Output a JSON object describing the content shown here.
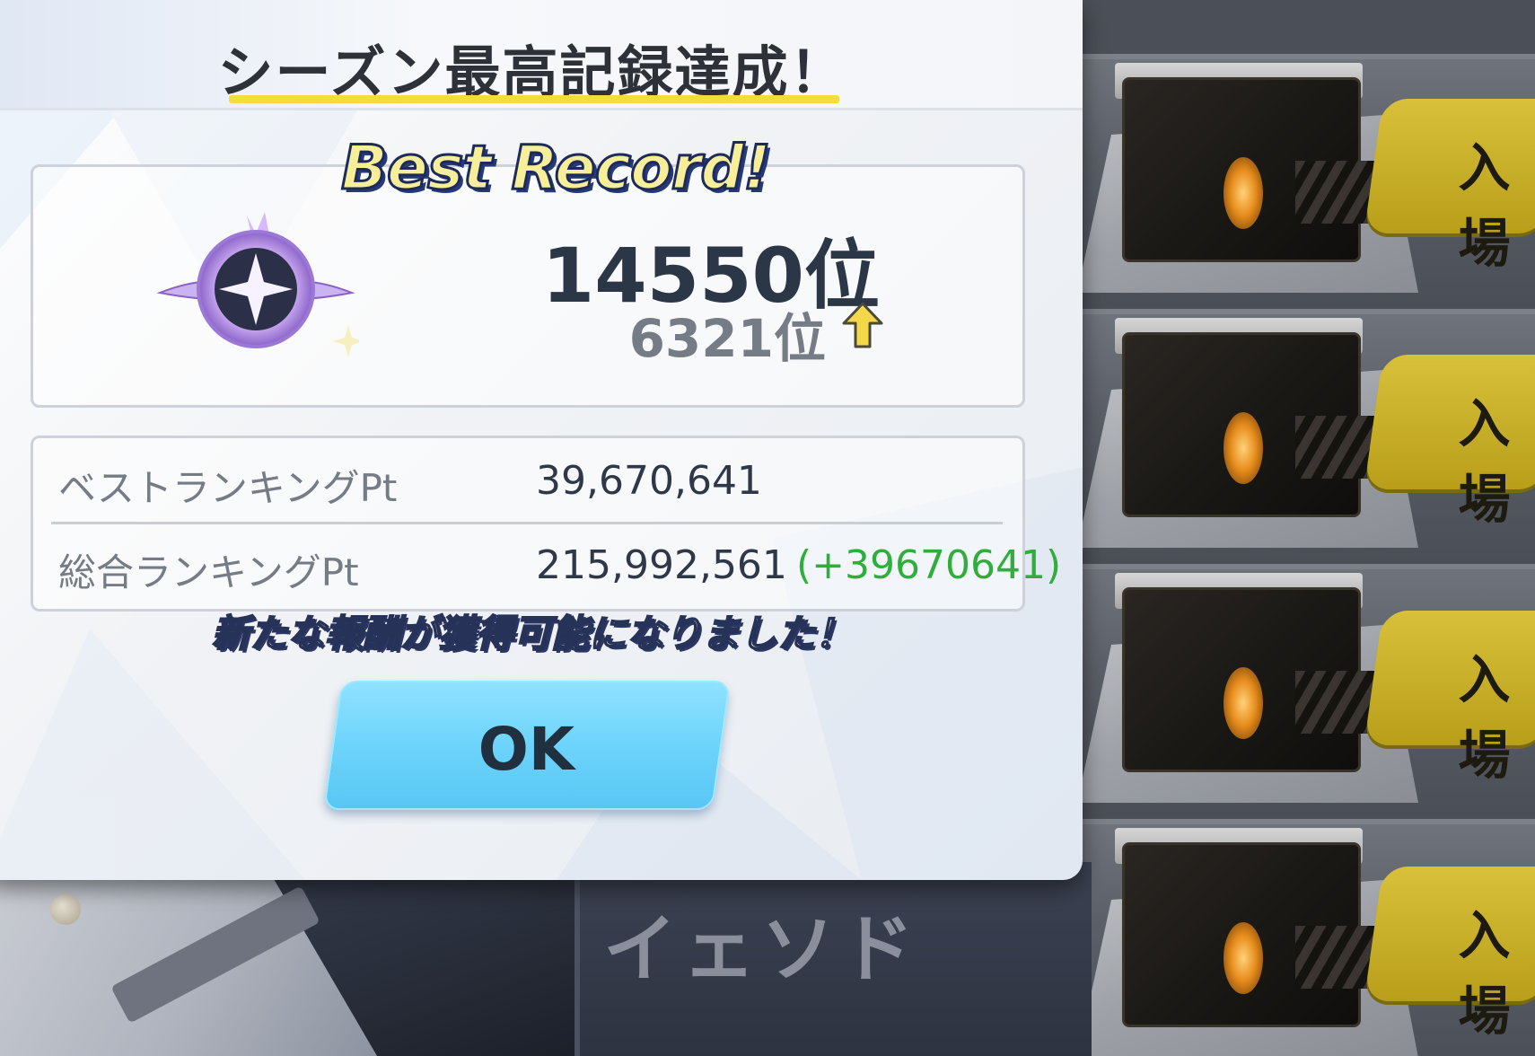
{
  "dialog": {
    "title": "シーズン最高記録達成！",
    "best_record_banner": "Best Record!",
    "rank": {
      "current": "14550位",
      "previous": "6321位"
    },
    "points": [
      {
        "label": "ベストランキングPt",
        "value": "39,670,641",
        "delta": ""
      },
      {
        "label": "総合ランキングPt",
        "value": "215,992,561",
        "delta": "(+39670641)"
      }
    ],
    "reward_message": "新たな報酬が獲得可能になりました！",
    "ok_label": "OK"
  },
  "background": {
    "character_name": "イェソド",
    "enter_buttons": [
      "入場",
      "入場",
      "入場",
      "入場"
    ]
  },
  "colors": {
    "accent_underline": "#f6dc3a",
    "ok_button": "#6dd4fb",
    "delta_green": "#2fae3c",
    "enter_button": "#d1b72e"
  }
}
